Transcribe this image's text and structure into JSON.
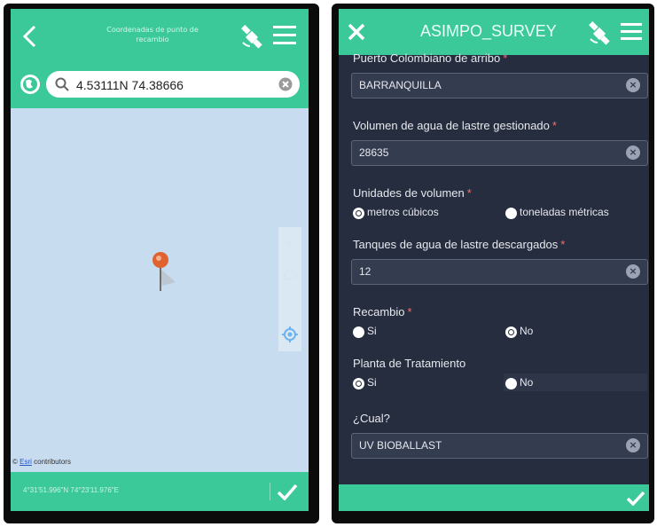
{
  "left": {
    "title": "Coordenadas de punto de recambio",
    "search_value": "4.53111N 74.38666",
    "attribution_link": "Esri",
    "attribution_text": "contributors",
    "coordinates": "4°31'51.996\"N 74°23'11.976\"E"
  },
  "right": {
    "title": "ASIMPO_SURVEY",
    "fields": [
      {
        "label": "Puerto Colombiano de arribo",
        "value": "BARRANQUILLA"
      },
      {
        "label": "Volumen de agua de lastre gestionado",
        "value": "28635"
      },
      {
        "label": "Tanques de agua de lastre descargados",
        "value": "12"
      },
      {
        "label": "¿Cual?",
        "value": "UV BIOBALLAST"
      }
    ],
    "radio_groups": [
      {
        "label": "Unidades de volumen",
        "options": [
          "metros cúbicos",
          "toneladas métricas"
        ],
        "selected": 0
      },
      {
        "label": "Recambio",
        "options": [
          "Si",
          "No"
        ],
        "selected": 1
      },
      {
        "label": "Planta de Tratamiento",
        "options": [
          "Si",
          "No"
        ],
        "selected": 0
      }
    ]
  },
  "colors": {
    "accent": "#3cc99a",
    "form_bg": "#262d3e",
    "map_bg": "#c7dcef"
  },
  "icons": [
    "back-chevron-icon",
    "satellite-icon",
    "hamburger-menu-icon",
    "globe-location-icon",
    "search-icon",
    "clear-icon",
    "zoom-in-icon",
    "home-icon",
    "zoom-out-icon",
    "gps-locate-icon",
    "map-pin-icon",
    "checkmark-icon",
    "close-x-icon"
  ]
}
